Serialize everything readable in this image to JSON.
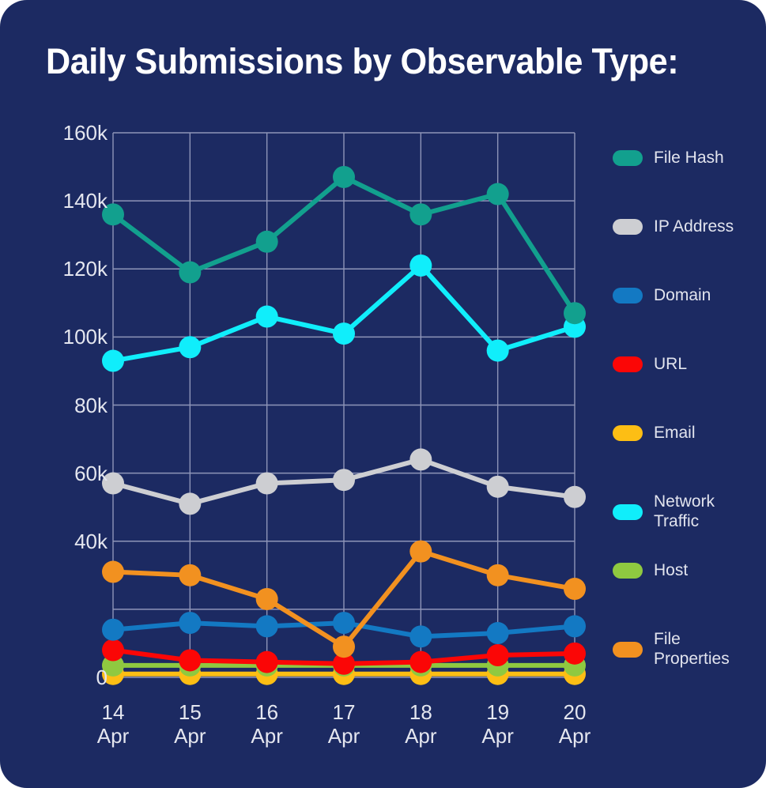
{
  "title": "Daily Submissions by Observable Type:",
  "colors": {
    "background": "#1c2a62",
    "grid": "#8e95b8",
    "axis_text": "#e4e6ef",
    "title_text": "#ffffff"
  },
  "y_axis": {
    "ticks": [
      "160k",
      "140k",
      "120k",
      "100k",
      "80k",
      "60k",
      "40k",
      "0"
    ],
    "tick_values": [
      160000,
      140000,
      120000,
      100000,
      80000,
      60000,
      40000,
      0
    ]
  },
  "x_axis": {
    "ticks": [
      {
        "day": "14",
        "month": "Apr"
      },
      {
        "day": "15",
        "month": "Apr"
      },
      {
        "day": "16",
        "month": "Apr"
      },
      {
        "day": "17",
        "month": "Apr"
      },
      {
        "day": "18",
        "month": "Apr"
      },
      {
        "day": "19",
        "month": "Apr"
      },
      {
        "day": "20",
        "month": "Apr"
      }
    ]
  },
  "legend": [
    {
      "label": "File Hash",
      "color": "#12a08e"
    },
    {
      "label": "IP Address",
      "color": "#cdced2"
    },
    {
      "label": "Domain",
      "color": "#1379c3"
    },
    {
      "label": "URL",
      "color": "#fb0606"
    },
    {
      "label": "Email",
      "color": "#fdbe14"
    },
    {
      "label": "Network\nTraffic",
      "color": "#10eefb"
    },
    {
      "label": "Host",
      "color": "#8fc940"
    },
    {
      "label": "File\nProperties",
      "color": "#f29120"
    }
  ],
  "chart_data": {
    "type": "line",
    "title": "Daily Submissions by Observable Type:",
    "xlabel": "",
    "ylabel": "",
    "categories": [
      "14 Apr",
      "15 Apr",
      "16 Apr",
      "17 Apr",
      "18 Apr",
      "19 Apr",
      "20 Apr"
    ],
    "ylim": [
      0,
      160000
    ],
    "ytick_step": 20000,
    "grid": true,
    "legend_position": "right",
    "markers": true,
    "series": [
      {
        "name": "File Hash",
        "color": "#12a08e",
        "values": [
          136000,
          119000,
          128000,
          147000,
          136000,
          142000,
          107000
        ]
      },
      {
        "name": "IP Address",
        "color": "#cdced2",
        "values": [
          57000,
          51000,
          57000,
          58000,
          64000,
          56000,
          53000
        ]
      },
      {
        "name": "Domain",
        "color": "#1379c3",
        "values": [
          14000,
          16000,
          15000,
          16000,
          12000,
          13000,
          15000
        ]
      },
      {
        "name": "URL",
        "color": "#fb0606",
        "values": [
          8000,
          5000,
          4500,
          4000,
          4500,
          6500,
          7000
        ]
      },
      {
        "name": "Email",
        "color": "#fdbe14",
        "values": [
          1000,
          1000,
          1000,
          1000,
          1000,
          1000,
          1000
        ]
      },
      {
        "name": "Network Traffic",
        "color": "#10eefb",
        "values": [
          93000,
          97000,
          106000,
          101000,
          121000,
          96000,
          103000
        ]
      },
      {
        "name": "Host",
        "color": "#8fc940",
        "values": [
          3500,
          3500,
          3500,
          3500,
          3500,
          3500,
          3500
        ]
      },
      {
        "name": "File Properties",
        "color": "#f29120",
        "values": [
          31000,
          30000,
          23000,
          9000,
          37000,
          30000,
          26000
        ]
      }
    ]
  }
}
